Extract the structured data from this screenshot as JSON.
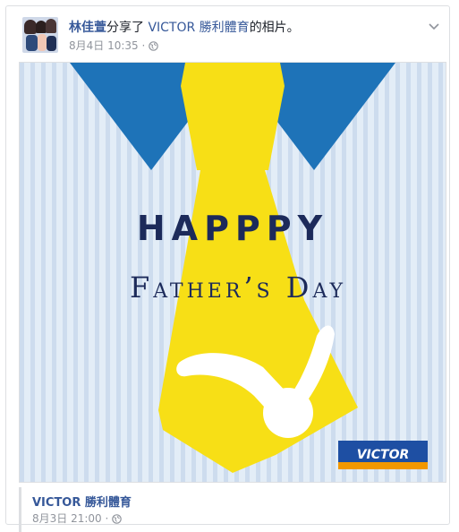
{
  "post": {
    "author": "林佳萱",
    "action_text": "分享了 ",
    "page_name": "VICTOR 勝利體育",
    "object_text": "的相片。",
    "date": "8月4日 10:35",
    "separator": " · ",
    "privacy_icon": "globe-icon",
    "menu_icon": "chevron-down-icon"
  },
  "poster": {
    "line1": "HAPPPY",
    "line2": "Father’s Day",
    "brand": "VICTOR",
    "colors": {
      "stripe_light": "#e3edf7",
      "stripe_dark": "#cddcee",
      "collar": "#1e73b8",
      "tie": "#f7df16",
      "text": "#1c2a5a",
      "brand_bg": "#1e4fa3",
      "brand_bar": "#f39800"
    }
  },
  "shared_source": {
    "page_name": "VICTOR 勝利體育",
    "date": "8月3日 21:00",
    "separator": " · ",
    "privacy_icon": "globe-icon"
  }
}
